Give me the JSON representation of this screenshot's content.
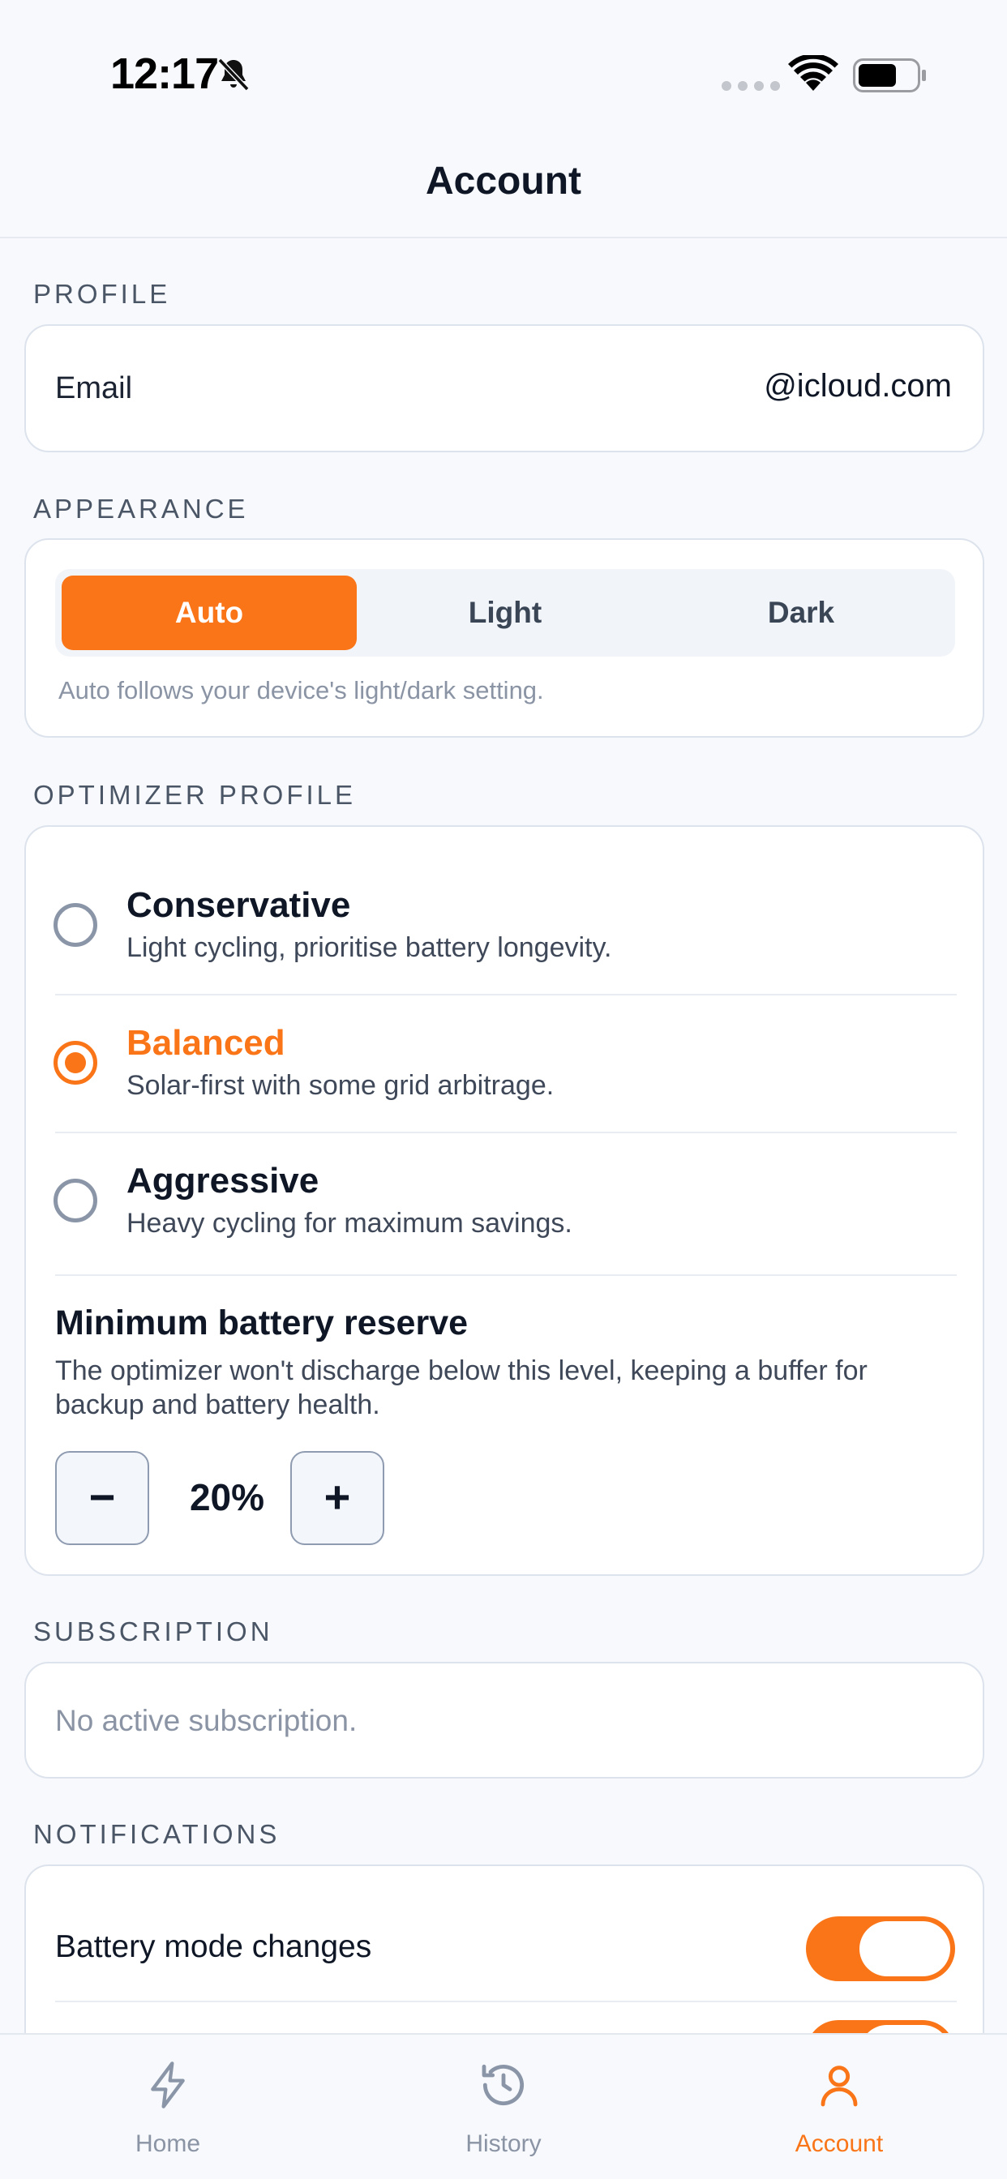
{
  "status_bar": {
    "time": "12:17"
  },
  "nav": {
    "title": "Account"
  },
  "profile": {
    "header": "PROFILE",
    "email_label": "Email",
    "email_value": "@icloud.com"
  },
  "appearance": {
    "header": "APPEARANCE",
    "options": [
      "Auto",
      "Light",
      "Dark"
    ],
    "selected": "Auto",
    "hint": "Auto follows your device's light/dark setting."
  },
  "optimizer": {
    "header": "OPTIMIZER PROFILE",
    "options": [
      {
        "title": "Conservative",
        "desc": "Light cycling, prioritise battery longevity."
      },
      {
        "title": "Balanced",
        "desc": "Solar-first with some grid arbitrage."
      },
      {
        "title": "Aggressive",
        "desc": "Heavy cycling for maximum savings."
      }
    ],
    "selected": "Balanced",
    "reserve_title": "Minimum battery reserve",
    "reserve_desc": "The optimizer won't discharge below this level, keeping a buffer for backup and battery health.",
    "reserve_value": "20%",
    "decrement_label": "−",
    "increment_label": "+"
  },
  "subscription": {
    "header": "SUBSCRIPTION",
    "status": "No active subscription."
  },
  "notifications": {
    "header": "NOTIFICATIONS",
    "items": [
      {
        "label": "Battery mode changes",
        "enabled": true
      }
    ]
  },
  "tab_bar": {
    "tabs": [
      {
        "label": "Home",
        "icon": "lightning-icon"
      },
      {
        "label": "History",
        "icon": "history-icon"
      },
      {
        "label": "Account",
        "icon": "person-icon"
      }
    ],
    "active": "Account"
  },
  "colors": {
    "accent": "#f97518",
    "background": "#f7f9fc",
    "card": "#ffffff",
    "muted_text": "#8a94a4"
  }
}
